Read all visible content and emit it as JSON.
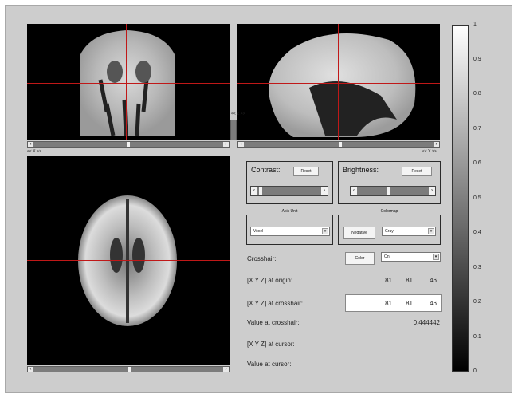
{
  "views": {
    "coronal_x_label": "<< X >>",
    "sagittal_y_label": "<< Y >>",
    "sagittal_z_label": "<< Z >>"
  },
  "contrast": {
    "label": "Contrast:",
    "reset": "Reset"
  },
  "brightness": {
    "label": "Brightness:",
    "reset": "Reset"
  },
  "axis_unit": {
    "title": "Axis Unit",
    "value": "Voxel"
  },
  "colormap": {
    "title": "Colormap",
    "negative": "Negative",
    "value": "Gray"
  },
  "crosshair": {
    "label": "Crosshair:",
    "color_button": "Color",
    "value": "On"
  },
  "info": {
    "origin_label": "[X Y Z] at origin:",
    "origin": [
      "81",
      "81",
      "46"
    ],
    "crosshair_label": "[X Y Z] at crosshair:",
    "crosshair": [
      "81",
      "81",
      "46"
    ],
    "value_crosshair_label": "Value at crosshair:",
    "value_crosshair": "0.444442",
    "cursor_label": "[X Y Z] at cursor:",
    "value_cursor_label": "Value at cursor:"
  },
  "colorbar": {
    "min": 0,
    "max": 1,
    "ticks": [
      "1",
      "0.9",
      "0.8",
      "0.7",
      "0.6",
      "0.5",
      "0.4",
      "0.3",
      "0.2",
      "0.1",
      "0"
    ]
  }
}
